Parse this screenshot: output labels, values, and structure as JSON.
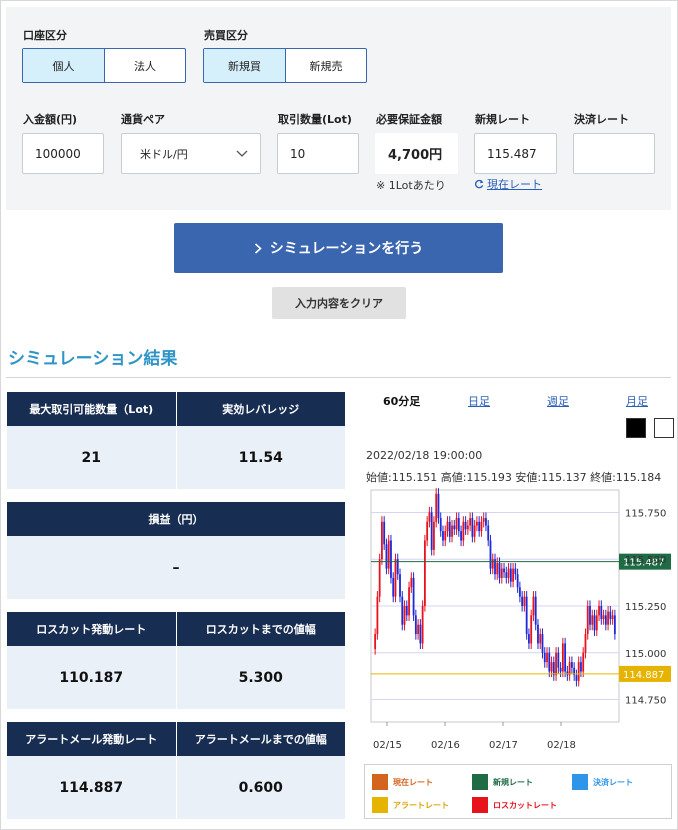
{
  "form": {
    "account_label": "口座区分",
    "account_options": [
      "個人",
      "法人"
    ],
    "trade_label": "売買区分",
    "trade_options": [
      "新規買",
      "新規売"
    ],
    "deposit_label": "入金額(円)",
    "deposit_value": "100000",
    "pair_label": "通貨ペア",
    "pair_value": "米ドル/円",
    "lots_label": "取引数量(Lot)",
    "lots_value": "10",
    "margin_label": "必要保証金額",
    "margin_value": "4,700円",
    "margin_note": "※ 1Lotあたり",
    "new_rate_label": "新規レート",
    "new_rate_value": "115.487",
    "current_rate_link": "現在レート",
    "settle_rate_label": "決済レート",
    "settle_rate_value": ""
  },
  "actions": {
    "simulate": "シミュレーションを行う",
    "clear": "入力内容をクリア"
  },
  "results": {
    "title": "シミュレーション結果",
    "max_lots_label": "最大取引可能数量（Lot)",
    "max_lots_value": "21",
    "leverage_label": "実効レバレッジ",
    "leverage_value": "11.54",
    "pl_label": "損益（円）",
    "pl_value": "–",
    "losscut_rate_label": "ロスカット発動レート",
    "losscut_rate_value": "110.187",
    "losscut_width_label": "ロスカットまでの値幅",
    "losscut_width_value": "5.300",
    "alert_rate_label": "アラートメール発動レート",
    "alert_rate_value": "114.887",
    "alert_width_label": "アラートメールまでの値幅",
    "alert_width_value": "0.600"
  },
  "chart_tabs": [
    "60分足",
    "日足",
    "週足",
    "月足"
  ],
  "ohlc": {
    "datetime": "2022/02/18 19:00:00",
    "summary": "始値:115.151 高値:115.193 安値:115.137 終値:115.184"
  },
  "legend": {
    "current": "現在レート",
    "new": "新規レート",
    "settle": "決済レート",
    "alert": "アラートレート",
    "losscut": "ロスカットレート"
  },
  "colors": {
    "up": "#e8121d",
    "down": "#1d28d8",
    "new_rate": "#1e6b45",
    "alert_rate": "#e6b400",
    "current": "#d2641e",
    "settle": "#2f95e8",
    "losscut": "#e8121d"
  },
  "chart_data": {
    "type": "candlestick",
    "x_ticks": [
      "02/15",
      "02/16",
      "02/17",
      "02/18"
    ],
    "y_ticks": [
      115.75,
      115.5,
      115.25,
      115.0,
      114.75
    ],
    "ylim": [
      114.63,
      115.87
    ],
    "new_rate": 115.487,
    "alert_rate": 114.887,
    "new_rate_label": "115.487",
    "alert_rate_label": "114.887",
    "closes": [
      115.1,
      115.3,
      115.5,
      115.7,
      115.58,
      115.45,
      115.6,
      115.4,
      115.3,
      115.5,
      115.42,
      115.3,
      115.15,
      115.25,
      115.2,
      115.35,
      115.4,
      115.2,
      115.1,
      115.15,
      115.05,
      115.25,
      115.6,
      115.7,
      115.75,
      115.55,
      115.7,
      115.85,
      115.72,
      115.65,
      115.6,
      115.65,
      115.7,
      115.62,
      115.68,
      115.66,
      115.72,
      115.65,
      115.6,
      115.7,
      115.66,
      115.68,
      115.72,
      115.62,
      115.68,
      115.7,
      115.65,
      115.7,
      115.72,
      115.68,
      115.6,
      115.45,
      115.5,
      115.42,
      115.48,
      115.4,
      115.45,
      115.43,
      115.4,
      115.45,
      115.38,
      115.45,
      115.42,
      115.35,
      115.3,
      115.25,
      115.3,
      115.1,
      115.05,
      115.2,
      115.3,
      115.15,
      115.05,
      115.1,
      115.0,
      114.95,
      115.0,
      114.9,
      114.95,
      114.88,
      115.0,
      114.92,
      114.9,
      115.05,
      114.9,
      114.88,
      114.95,
      114.92,
      114.88,
      114.85,
      114.95,
      114.9,
      115.0,
      115.1,
      115.25,
      115.15,
      115.2,
      115.12,
      115.2,
      115.25,
      115.18,
      115.2,
      115.15,
      115.22,
      115.18,
      115.2,
      115.1
    ]
  }
}
